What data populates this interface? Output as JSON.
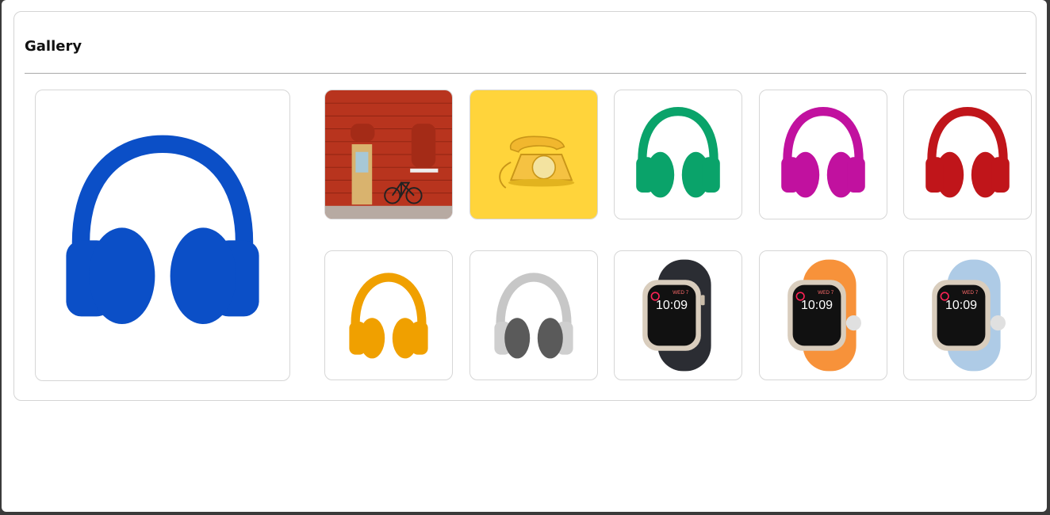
{
  "gallery": {
    "title": "Gallery",
    "featured": {
      "icon": "blue-headphones-image",
      "color": "#0b4fc7"
    },
    "thumbnails": [
      {
        "icon": "red-brick-wall-bicycle-image"
      },
      {
        "icon": "yellow-telephone-image"
      },
      {
        "icon": "green-headphones-image",
        "color": "#0aa36a"
      },
      {
        "icon": "magenta-headphones-image",
        "color": "#c1119f"
      },
      {
        "icon": "red-headphones-image",
        "color": "#c0151a"
      },
      {
        "icon": "orange-headphones-image",
        "color": "#f0a000"
      },
      {
        "icon": "silver-headphones-image",
        "color": "#bdbdbd"
      },
      {
        "icon": "black-smartwatch-image",
        "color": "#2b2d33"
      },
      {
        "icon": "orange-smartwatch-image",
        "color": "#f7923a"
      },
      {
        "icon": "light-blue-smartwatch-image",
        "color": "#aecbe6"
      }
    ],
    "watch_screen": {
      "time": "10:09",
      "date": "WED 7"
    }
  }
}
